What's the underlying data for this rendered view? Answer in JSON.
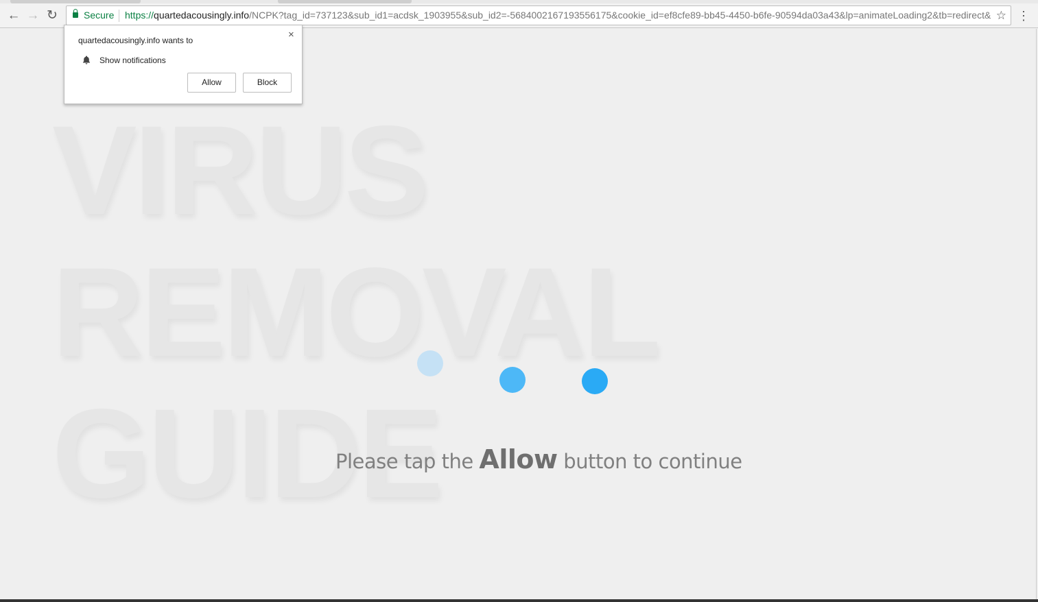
{
  "browser": {
    "secure_label": "Secure",
    "url_scheme": "https://",
    "url_host": "quartedacousingly.info",
    "url_rest": "/NCPK?tag_id=737123&sub_id1=acdsk_1903955&sub_id2=-5684002167193556175&cookie_id=ef8cfe89-bb45-4450-b6fe-90594da03a43&lp=animateLoading2&tb=redirect&"
  },
  "popup": {
    "title": "quartedacousingly.info wants to",
    "permission": "Show notifications",
    "allow_label": "Allow",
    "block_label": "Block",
    "close_glyph": "×"
  },
  "page": {
    "watermark": [
      "VIRUS",
      "REMOVAL",
      "GUIDE"
    ],
    "message_before": "Please tap the ",
    "message_emphasis": "Allow",
    "message_after": " button to continue",
    "dot_colors": [
      "#c5e1f5",
      "#4db8f7",
      "#2aaaf5"
    ]
  }
}
